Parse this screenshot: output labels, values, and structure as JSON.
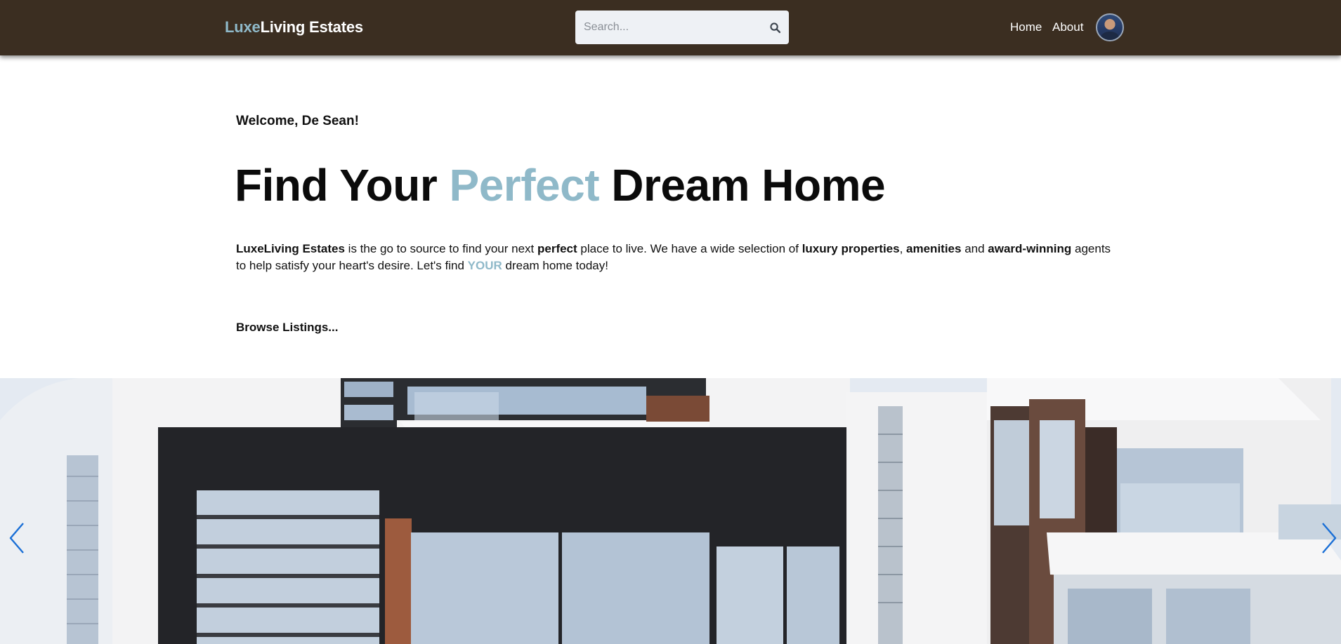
{
  "header": {
    "brand_accent": "Luxe",
    "brand_rest": "Living Estates",
    "search_placeholder": "Search...",
    "search_icon": "search-icon",
    "nav": {
      "home": "Home",
      "about": "About"
    },
    "avatar": "user-avatar"
  },
  "hero": {
    "welcome": "Welcome, De Sean!",
    "headline_part1": "Find Your ",
    "headline_accent": "Perfect",
    "headline_part2": " Dream Home",
    "intro": {
      "brand": "LuxeLiving Estates",
      "t1": " is the go to source to find your next ",
      "perfect": "perfect",
      "t2": " place to live. We have a wide selection of ",
      "luxury": "luxury properties",
      "t3": ", ",
      "amenities": "amenities",
      "t4": " and ",
      "award": "award-winning",
      "t5": " agents to help satisfy your heart's desire. Let's find ",
      "your": "YOUR",
      "t6": " dream home today!"
    },
    "browse": "Browse Listings..."
  },
  "carousel": {
    "prev_icon": "chevron-left-icon",
    "next_icon": "chevron-right-icon"
  },
  "colors": {
    "header_bg": "#3b2e21",
    "accent": "#8fb9c9",
    "arrow": "#1a6fd6"
  }
}
